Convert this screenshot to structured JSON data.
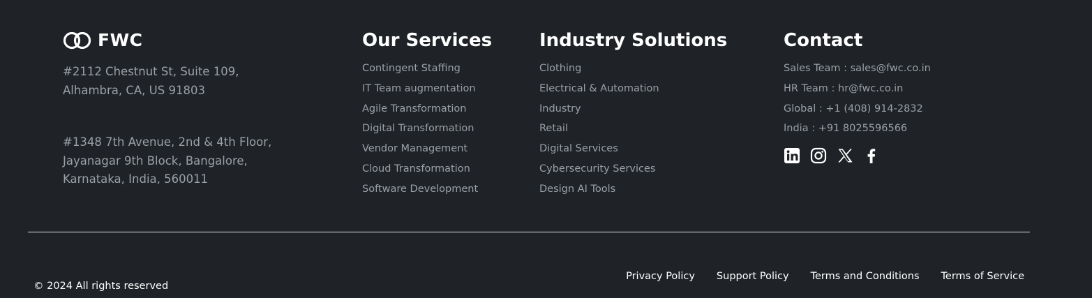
{
  "brand": {
    "logo_text": "FWC",
    "addresses": [
      [
        "#2112 Chestnut St, Suite 109,",
        "Alhambra, CA, US 91803"
      ],
      [
        "#1348 7th Avenue, 2nd & 4th Floor,",
        "Jayanagar 9th Block, Bangalore,",
        "Karnataka, India, 560011"
      ]
    ]
  },
  "services": {
    "title": "Our Services",
    "items": [
      "Contingent Staffing",
      "IT Team augmentation",
      "Agile Transformation",
      "Digital Transformation",
      "Vendor Management",
      "Cloud Transformation",
      "Software Development"
    ]
  },
  "industry": {
    "title": "Industry Solutions",
    "items": [
      "Clothing",
      "Electrical & Automation",
      "Industry",
      "Retail",
      "Digital Services",
      "Cybersecurity Services",
      "Design AI Tools"
    ]
  },
  "contact": {
    "title": "Contact",
    "items": [
      "Sales Team : sales@fwc.co.in",
      "HR Team : hr@fwc.co.in",
      "Global : +1 (408) 914-2832",
      "India : +91 8025596566"
    ],
    "socials": [
      "linkedin-icon",
      "instagram-icon",
      "x-icon",
      "facebook-icon"
    ]
  },
  "bottom": {
    "copyright": "© 2024 All rights reserved",
    "links": [
      "Privacy Policy",
      "Support Policy",
      "Terms and Conditions",
      "Terms of Service"
    ]
  },
  "colors": {
    "background": "#1f2327",
    "muted_text": "#9aa0a6",
    "heading": "#ffffff"
  }
}
